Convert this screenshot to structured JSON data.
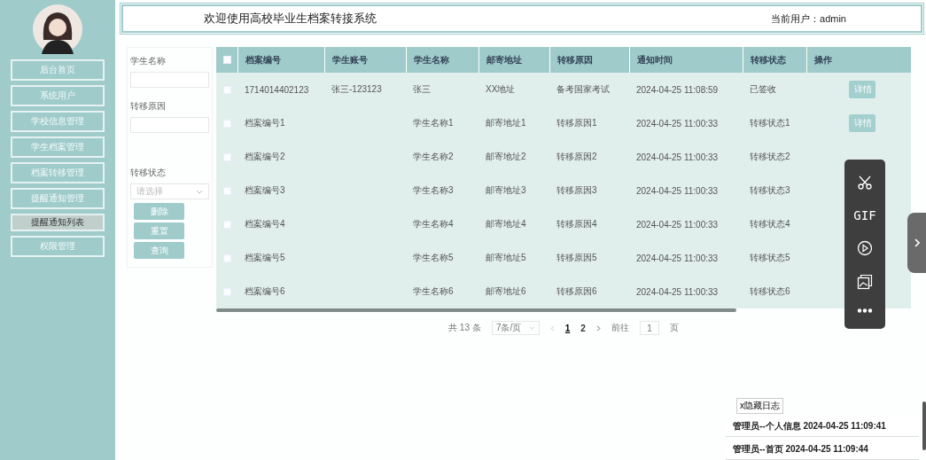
{
  "sidebar": {
    "items": [
      {
        "label": "后台首页",
        "selected": false
      },
      {
        "label": "系统用户",
        "selected": false
      },
      {
        "label": "学校信息管理",
        "selected": false
      },
      {
        "label": "学生档案管理",
        "selected": false
      },
      {
        "label": "档案转移管理",
        "selected": false
      },
      {
        "label": "提醒通知管理",
        "selected": false
      },
      {
        "label": "提醒通知列表",
        "selected": true
      },
      {
        "label": "权限管理",
        "selected": false
      }
    ]
  },
  "header": {
    "title": "欢迎使用高校毕业生档案转接系统",
    "user": "当前用户：admin"
  },
  "filters": {
    "fields": [
      {
        "label": "学生名称",
        "kind": "text"
      },
      {
        "label": "转移原因",
        "kind": "text"
      },
      {
        "label": "转移状态",
        "kind": "select",
        "placeholder": "请选择"
      }
    ],
    "buttons": [
      "删除",
      "重置",
      "查询"
    ]
  },
  "table": {
    "all_selected": false,
    "columns": [
      "档案编号",
      "学生账号",
      "学生名称",
      "邮寄地址",
      "转移原因",
      "通知时间",
      "转移状态",
      "操作"
    ],
    "rows": [
      {
        "selected": false,
        "cells": [
          "1714014402123",
          "张三-123123",
          "张三",
          "XX地址",
          "备考国家考试",
          "2024-04-25 11:08:59",
          "已签收"
        ],
        "action": "详情"
      },
      {
        "selected": false,
        "cells": [
          "档案编号1",
          "",
          "学生名称1",
          "邮寄地址1",
          "转移原因1",
          "2024-04-25 11:00:33",
          "转移状态1"
        ],
        "action": "详情"
      },
      {
        "selected": false,
        "cells": [
          "档案编号2",
          "",
          "学生名称2",
          "邮寄地址2",
          "转移原因2",
          "2024-04-25 11:00:33",
          "转移状态2"
        ]
      },
      {
        "selected": false,
        "cells": [
          "档案编号3",
          "",
          "学生名称3",
          "邮寄地址3",
          "转移原因3",
          "2024-04-25 11:00:33",
          "转移状态3"
        ]
      },
      {
        "selected": false,
        "cells": [
          "档案编号4",
          "",
          "学生名称4",
          "邮寄地址4",
          "转移原因4",
          "2024-04-25 11:00:33",
          "转移状态4"
        ]
      },
      {
        "selected": false,
        "cells": [
          "档案编号5",
          "",
          "学生名称5",
          "邮寄地址5",
          "转移原因5",
          "2024-04-25 11:00:33",
          "转移状态5"
        ]
      },
      {
        "selected": false,
        "cells": [
          "档案编号6",
          "",
          "学生名称6",
          "邮寄地址6",
          "转移原因6",
          "2024-04-25 11:00:33",
          "转移状态6"
        ]
      }
    ]
  },
  "pagination": {
    "total": "共 13 条",
    "page_size": "7条/页",
    "pages": [
      {
        "label": "1",
        "selected": true
      },
      {
        "label": "2",
        "selected": false
      }
    ],
    "goto_label": "前往",
    "goto_value": "1",
    "goto_unit": "页"
  },
  "toolbar": {
    "items": [
      {
        "kind": "scissors"
      },
      {
        "kind": "text",
        "label": "GIF"
      },
      {
        "kind": "play"
      },
      {
        "kind": "gallery"
      },
      {
        "kind": "more"
      }
    ]
  },
  "log": {
    "toggle": "x隐藏日志",
    "entries": [
      "管理员--个人信息 2024-04-25 11:09:41",
      "管理员--首页 2024-04-25 11:09:44"
    ]
  }
}
